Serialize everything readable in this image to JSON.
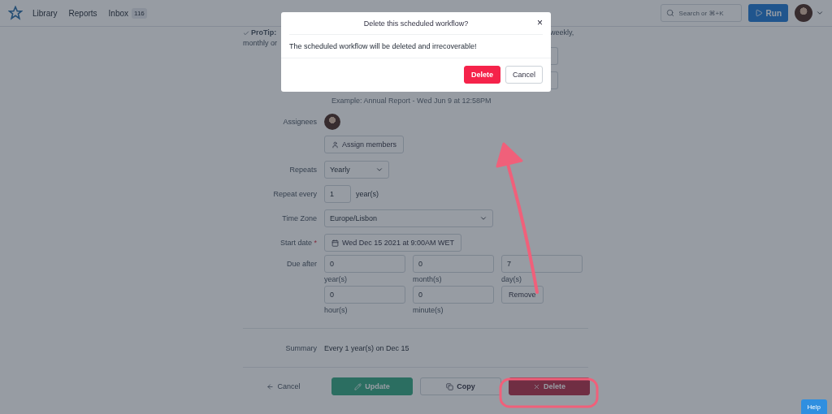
{
  "nav": {
    "items": [
      {
        "label": "Library"
      },
      {
        "label": "Reports"
      },
      {
        "label": "Inbox",
        "badge": "116"
      }
    ],
    "search": {
      "placeholder": "Search or ⌘+K"
    },
    "run_button": "Run"
  },
  "protip": {
    "lead": "ProTip:",
    "line2": "monthly or",
    "tail": "weekly,"
  },
  "example": "Example: Annual Report - Wed Jun 9 at 12:58PM",
  "form": {
    "assignees_label": "Assignees",
    "assign_button": "Assign members",
    "repeats_label": "Repeats",
    "repeats_value": "Yearly",
    "repeat_every_label": "Repeat every",
    "repeat_every_value": "1",
    "repeat_every_unit": "year(s)",
    "timezone_label": "Time Zone",
    "timezone_value": "Europe/Lisbon",
    "start_label": "Start date",
    "start_required_mark": "*",
    "start_value": "Wed Dec 15 2021 at 9:00AM WET",
    "due_label": "Due after",
    "due_fields": [
      {
        "value": "0",
        "unit": "year(s)"
      },
      {
        "value": "0",
        "unit": "month(s)"
      },
      {
        "value": "7",
        "unit": "day(s)"
      },
      {
        "value": "0",
        "unit": "hour(s)"
      },
      {
        "value": "0",
        "unit": "minute(s)"
      }
    ],
    "remove_button": "Remove",
    "summary_label": "Summary",
    "summary_value": "Every 1 year(s) on Dec 15"
  },
  "actions": {
    "cancel": "Cancel",
    "update": "Update",
    "copy": "Copy",
    "delete": "Delete"
  },
  "help": "Help",
  "modal": {
    "title": "Delete this scheduled workflow?",
    "close": "×",
    "message": "The scheduled workflow will be deleted and irrecoverable!",
    "delete": "Delete",
    "cancel": "Cancel"
  }
}
